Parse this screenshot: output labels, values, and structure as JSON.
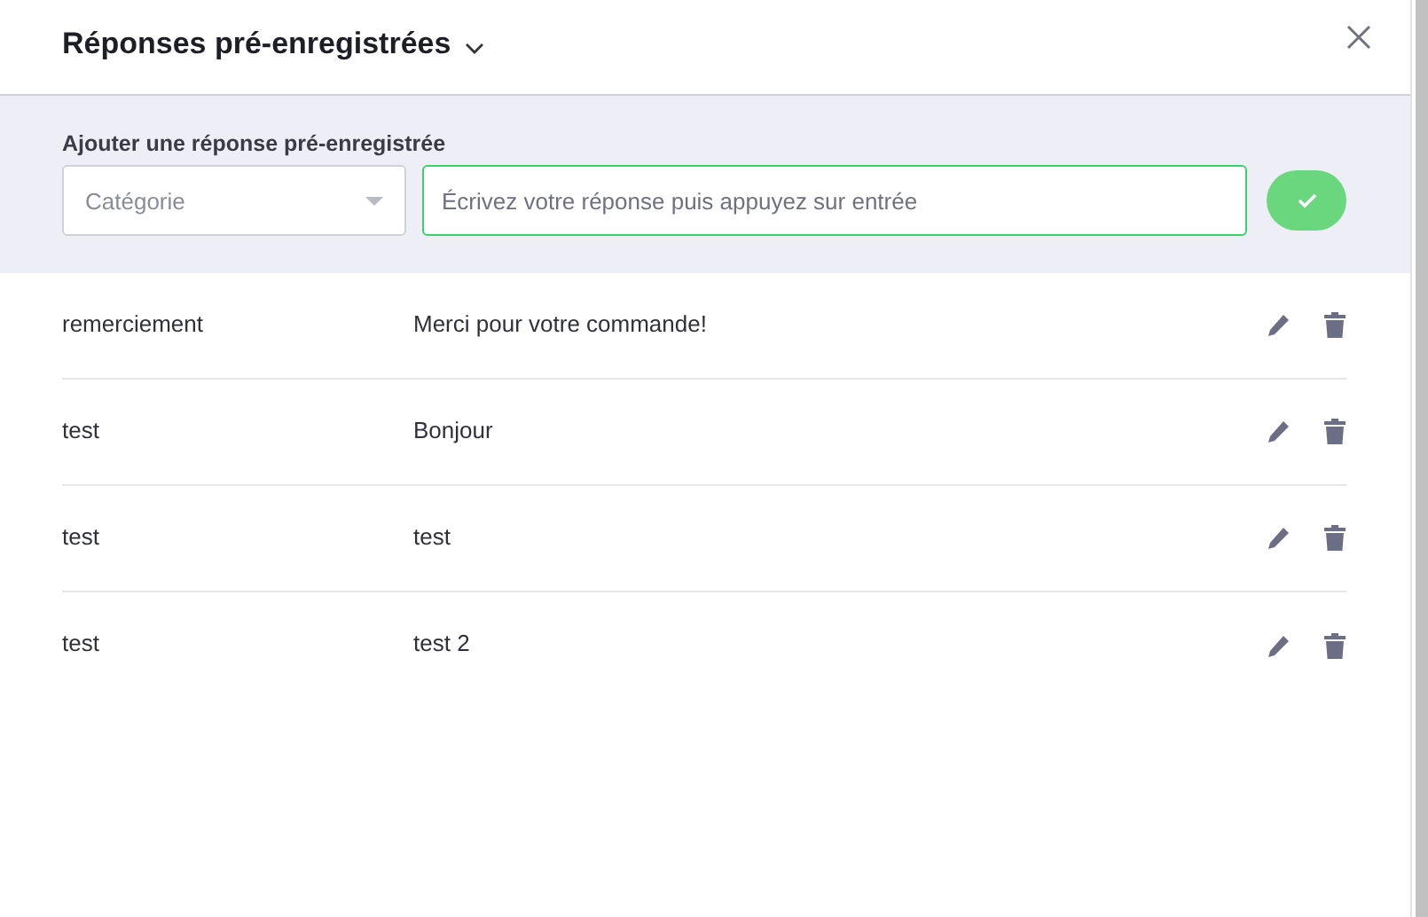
{
  "header": {
    "title": "Réponses pré-enregistrées"
  },
  "add_form": {
    "label": "Ajouter une réponse pré-enregistrée",
    "category": {
      "placeholder": "Catégorie"
    },
    "response": {
      "placeholder": "Écrivez votre réponse puis appuyez sur entrée"
    }
  },
  "responses": [
    {
      "category": "remerciement",
      "text": "Merci pour votre commande!"
    },
    {
      "category": "test",
      "text": "Bonjour"
    },
    {
      "category": "test",
      "text": "test"
    },
    {
      "category": "test",
      "text": "test 2"
    }
  ]
}
